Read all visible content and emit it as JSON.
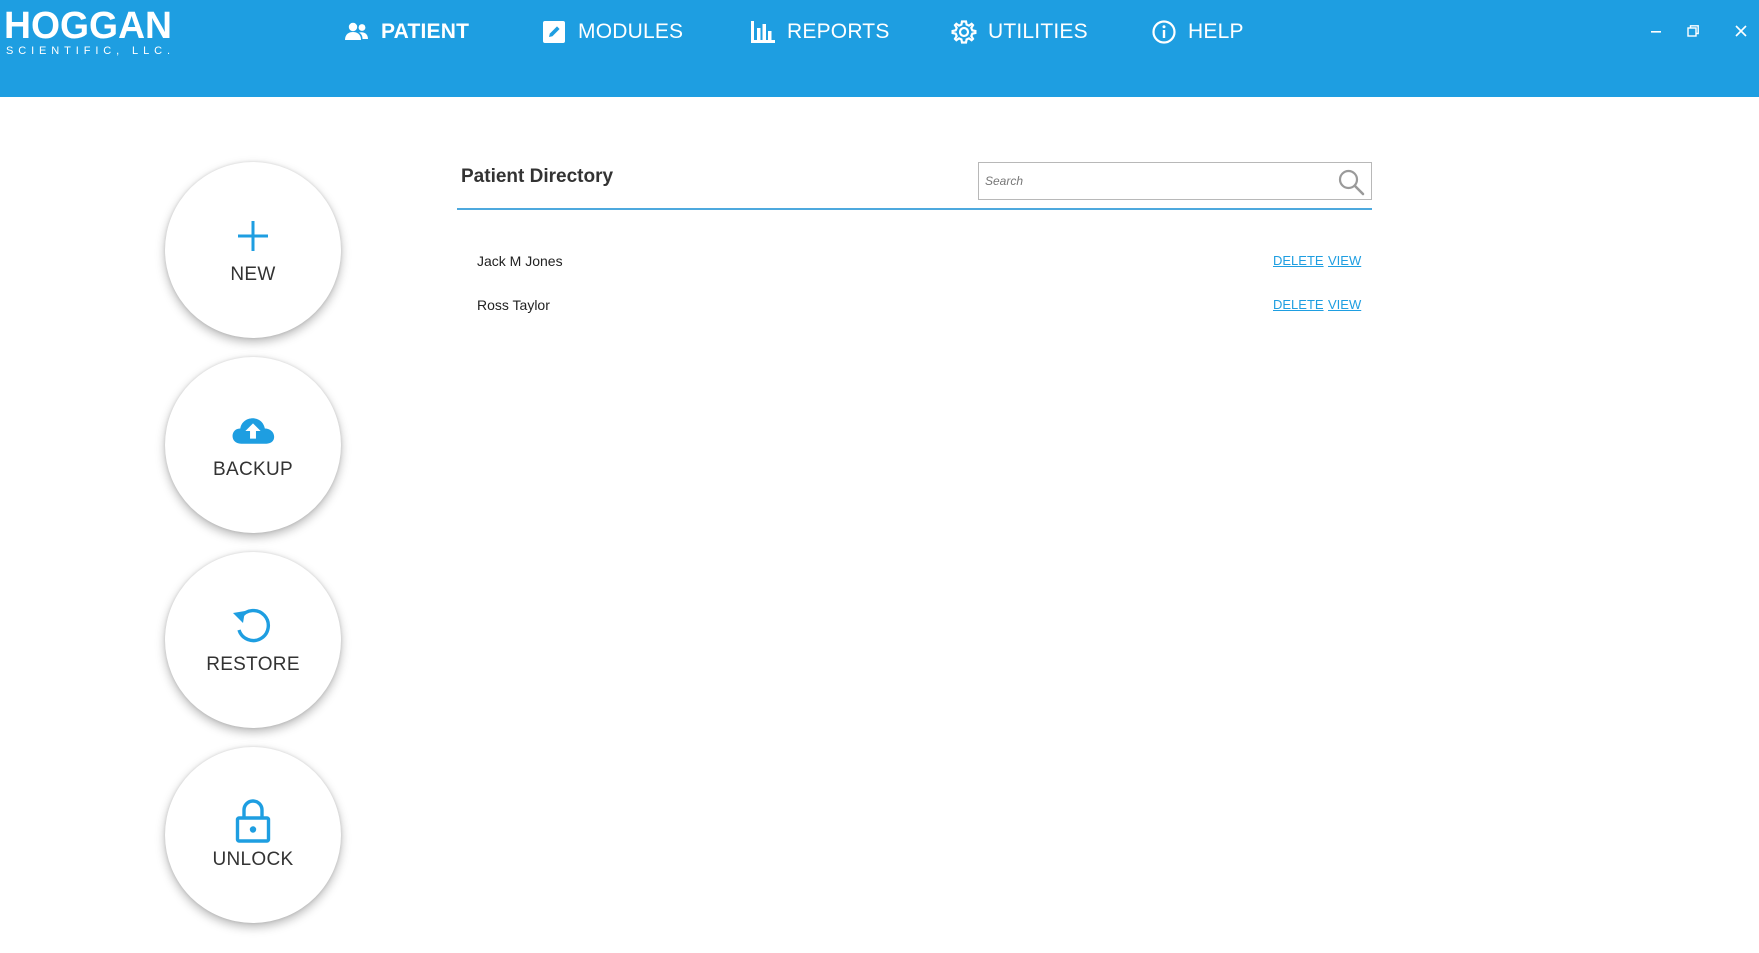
{
  "app": {
    "brand": "HOGGAN",
    "brand_sub": "SCIENTIFIC, LLC.",
    "accent_color": "#1e9ee1"
  },
  "nav": {
    "items": [
      {
        "label": "PATIENT",
        "icon": "users-icon",
        "active": true
      },
      {
        "label": "MODULES",
        "icon": "edit-icon",
        "active": false
      },
      {
        "label": "REPORTS",
        "icon": "bar-chart-icon",
        "active": false
      },
      {
        "label": "UTILITIES",
        "icon": "gear-icon",
        "active": false
      },
      {
        "label": "HELP",
        "icon": "info-icon",
        "active": false
      }
    ]
  },
  "window_controls": {
    "minimize": "minimize-icon",
    "restore": "restore-icon",
    "close": "close-icon"
  },
  "actions": [
    {
      "label": "NEW",
      "icon": "plus-icon"
    },
    {
      "label": "BACKUP",
      "icon": "cloud-upload-icon"
    },
    {
      "label": "RESTORE",
      "icon": "restore-history-icon"
    },
    {
      "label": "UNLOCK",
      "icon": "lock-icon"
    }
  ],
  "directory": {
    "title": "Patient Directory",
    "search_placeholder": "Search",
    "patients": [
      {
        "name": "Jack M Jones",
        "delete_label": "DELETE",
        "view_label": "VIEW"
      },
      {
        "name": "Ross Taylor",
        "delete_label": "DELETE",
        "view_label": "VIEW"
      }
    ]
  }
}
